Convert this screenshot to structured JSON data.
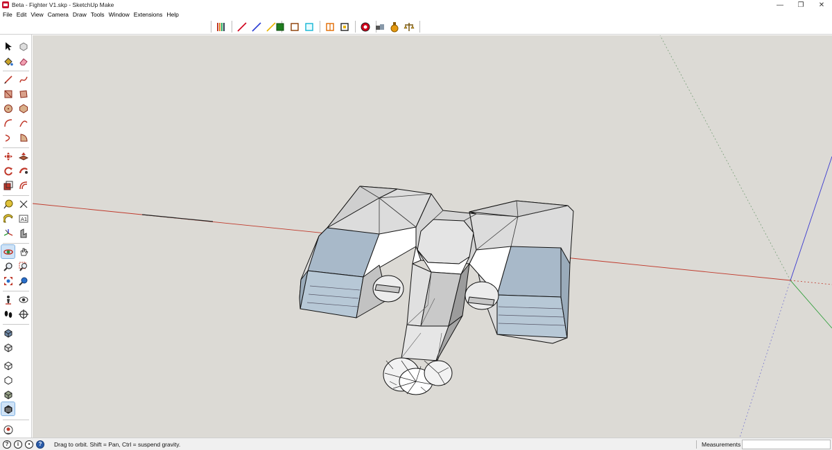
{
  "window": {
    "title": "Beta - Fighter V1.skp - SketchUp Make",
    "controls": {
      "minimize": "—",
      "restore": "❐",
      "close": "✕"
    }
  },
  "menu": [
    "File",
    "Edit",
    "View",
    "Camera",
    "Draw",
    "Tools",
    "Window",
    "Extensions",
    "Help"
  ],
  "top_toolbar": {
    "groups": [
      [
        "sandbox-contours-icon",
        "red-axis-line-icon",
        "blue-axis-line-icon",
        "yellow-axis-line-icon"
      ],
      [
        "solid-fill-icon",
        "hollow-square-icon",
        "cyan-square-icon",
        "split-square-icon",
        "bracket-square-icon",
        "section-plane-icon"
      ],
      [
        "extension-warehouse-icon",
        "potion-icon",
        "scales-icon"
      ]
    ]
  },
  "left_toolbar": {
    "tools": [
      "select-icon",
      "component-icon",
      "paint-bucket-icon",
      "eraser-icon",
      "line-icon",
      "freehand-icon",
      "rectangle-icon",
      "rotated-rectangle-icon",
      "circle-icon",
      "polygon-icon",
      "arc-icon",
      "two-point-arc-icon",
      "three-point-arc-icon",
      "pie-icon",
      "move-icon",
      "push-pull-icon",
      "rotate-icon",
      "follow-me-icon",
      "scale-icon",
      "offset-icon",
      "tape-measure-icon",
      "dimension-icon",
      "protractor-icon",
      "text-icon",
      "axes-icon",
      "3d-text-icon",
      "orbit-icon",
      "pan-icon",
      "zoom-icon",
      "zoom-window-icon",
      "zoom-extents-icon",
      "previous-view-icon",
      "position-camera-icon",
      "look-around-icon",
      "walk-icon",
      "section-icon",
      "xray-style-icon",
      "back-edges-style-icon",
      "wireframe-style-icon",
      "hidden-line-style-icon",
      "shaded-style-icon",
      "shaded-textures-style-icon",
      "geolocation-icon"
    ],
    "active_tool": "orbit-icon"
  },
  "status": {
    "hint": "Drag to orbit. Shift = Pan, Ctrl = suspend gravity.",
    "measurements_label": "Measurements",
    "measurements_value": ""
  },
  "colors": {
    "viewport_bg": "#dcdad5",
    "axis_red": "#c0392b",
    "axis_blue": "#3a3ad0",
    "axis_green": "#2f9e3a",
    "face_front": "#e8e8e8",
    "face_back": "#a9b9c8"
  }
}
